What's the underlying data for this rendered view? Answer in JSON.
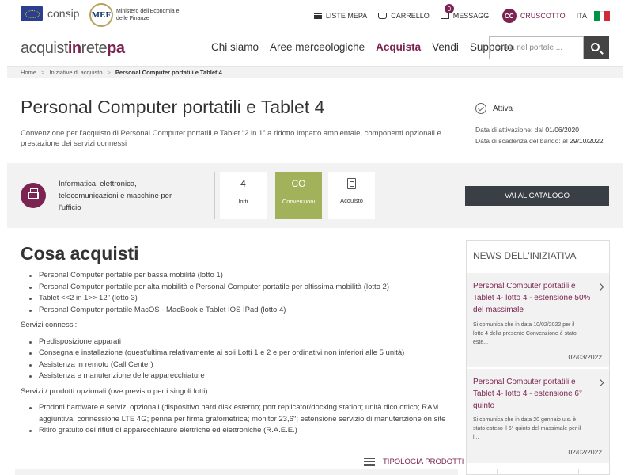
{
  "header": {
    "consip_label": "consip",
    "mef_logo": "MEF",
    "mef_text": "Ministero dell'Economia e delle Finanze",
    "liste_mepa": "LISTE MEPA",
    "carrello": "CARRELLO",
    "messaggi": "MESSAGGI",
    "messaggi_count": "0",
    "avatar_initials": "CC",
    "cruscotto": "CRUSCOTTO",
    "language": "ITA",
    "flag_colors": [
      "#009246",
      "#ffffff",
      "#ce2b37"
    ]
  },
  "nav": {
    "brand_a": "acquist",
    "brand_b": "in",
    "brand_c": "rete",
    "brand_d": "pa",
    "links": [
      "Chi siamo",
      "Aree merceologiche",
      "Acquista",
      "Vendi",
      "Supporto"
    ],
    "active": "Acquista",
    "search_placeholder": "cerca nel portale ..."
  },
  "breadcrumb": [
    "Home",
    "Iniziative di acquisto",
    "Personal Computer portatili e Tablet 4"
  ],
  "page": {
    "title": "Personal Computer portatili e Tablet 4",
    "description": "Convenzione per l'acquisto di Personal Computer portatili e Tablet “2 in 1” a ridotto impatto ambientale, componenti opzionali e prestazione dei servizi connessi",
    "status": "Attiva",
    "activation_label": "Data di attivazione: dal",
    "activation_date": "01/06/2020",
    "expiry_label": "Data di scadenza del bando: al",
    "expiry_date": "29/10/2022"
  },
  "category": {
    "name": "Informatica, elettronica, telecomunicazioni e macchine per l'ufficio",
    "icon": "printer-icon",
    "stats": [
      {
        "value": "4",
        "label": "lotti"
      },
      {
        "value": "CO",
        "label": "Convenzioni"
      },
      {
        "value": "",
        "label": "Acquisto"
      }
    ],
    "catalog_button": "VAI AL CATALOGO",
    "accent": "#a2b25a"
  },
  "content": {
    "title": "Cosa acquisti",
    "products": [
      "Personal Computer portatile per bassa mobilità (lotto 1)",
      "Personal Computer portatile per alta mobilità e Personal Computer portatile per altissima mobilità (lotto 2)",
      "Tablet <<2 in 1>> 12\" (lotto 3)",
      "Personal Computer portatile MacOS - MacBook e Tablet IOS IPad (lotto 4)"
    ],
    "services_heading": "Servizi connessi:",
    "services": [
      "Predisposizione apparati",
      "Consegna e installazione (quest'ultima relativamente ai soli Lotti 1 e 2 e per ordinativi non inferiori alle 5 unità)",
      "Assistenza in remoto (Call Center)",
      "Assistenza e manutenzione delle apparecchiature"
    ],
    "optional_heading": "Servizi / prodotti opzionali (ove previsto per i singoli lotti):",
    "optional": [
      "Prodotti hardware e servizi opzionali (dispositivo hard disk esterno; port replicator/docking station; unità dico ottico; RAM aggiuntiva; connessione LTE 4G; penna per firma grafometrica; monitor 23,6\"; estensione servizio di manutenzione on site",
      "Ritiro gratuito dei rifiuti di apparecchiature elettriche ed elettroniche (R.A.E.E.)"
    ],
    "tipologia": "TIPOLOGIA PRODOTTI"
  },
  "news": {
    "heading": "NEWS DELL'INIZIATIVA",
    "items": [
      {
        "title": "Personal Computer portatili e Tablet 4- lotto 4 - estensione 50% del massimale",
        "body": "Si comunica che in data 10/02/2022 per il lotto 4 della presente Convenzione è stato este...",
        "date": "02/03/2022"
      },
      {
        "title": "Personal Computer portatili e Tablet 4- lotto 4 - estensione 6° quinto",
        "body": "Si comunica che in data 20 gennaio u.s. è stato esteso il 6° quinto del massimale per il l...",
        "date": "02/02/2022"
      }
    ]
  },
  "colors": {
    "brand": "#7b2451",
    "dark_button": "#3a3f45"
  }
}
